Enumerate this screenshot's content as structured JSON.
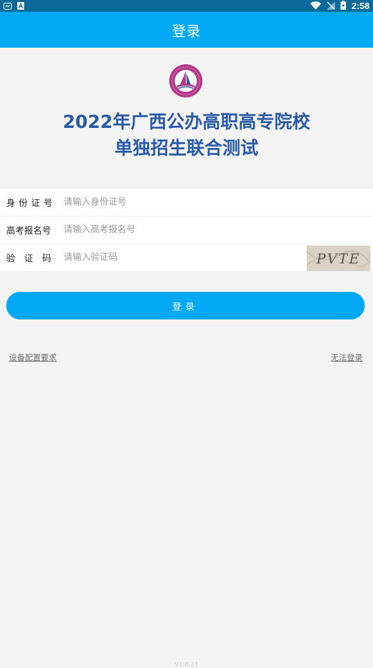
{
  "status_bar": {
    "time": "2:58",
    "icons": [
      "notification-icon",
      "font-icon",
      "wifi-icon",
      "no-sim-icon",
      "battery-charging-icon"
    ]
  },
  "app_bar": {
    "title": "登录"
  },
  "headline": {
    "line1": "2022年广西公办高职高专院校",
    "line2": "单独招生联合测试"
  },
  "form": {
    "id_number": {
      "label": "身份证号",
      "placeholder": "请输入身份证号"
    },
    "exam_number": {
      "label": "高考报名号",
      "placeholder": "请输入高考报名号"
    },
    "captcha": {
      "label": "验证码",
      "placeholder": "请输入验证码",
      "image_text": "PVTE"
    }
  },
  "login_button": {
    "label": "登录"
  },
  "links": {
    "device_requirements": "设备配置要求",
    "cannot_login": "无法登录"
  },
  "version": "V1.0.21",
  "colors": {
    "primary": "#03a9f4",
    "status_bar": "#0b6a9a",
    "headline": "#2a5ba8",
    "logo": "#b0378a",
    "background": "#f4f4f4"
  }
}
